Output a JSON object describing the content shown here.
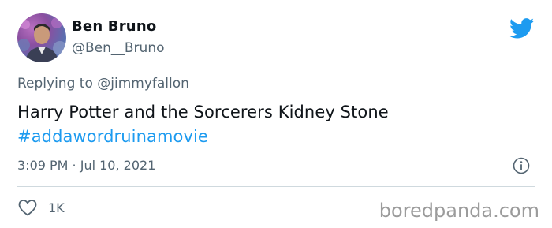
{
  "author": {
    "display_name": "Ben Bruno",
    "handle": "@Ben__Bruno"
  },
  "reply": {
    "prefix": "Replying to",
    "mention": "@jimmyfallon"
  },
  "tweet": {
    "text": "Harry Potter and the Sorcerers Kidney Stone",
    "hashtag": "#addawordruinamovie",
    "timestamp": "3:09 PM · Jul 10, 2021"
  },
  "actions": {
    "like_count": "1K"
  },
  "watermark": "boredpanda.com",
  "icons": {
    "brand": "twitter-bird-icon",
    "info": "info-icon",
    "like": "heart-icon"
  },
  "colors": {
    "link_blue": "#1d9bf0",
    "secondary_text": "#536471",
    "primary_text": "#0f1419"
  }
}
